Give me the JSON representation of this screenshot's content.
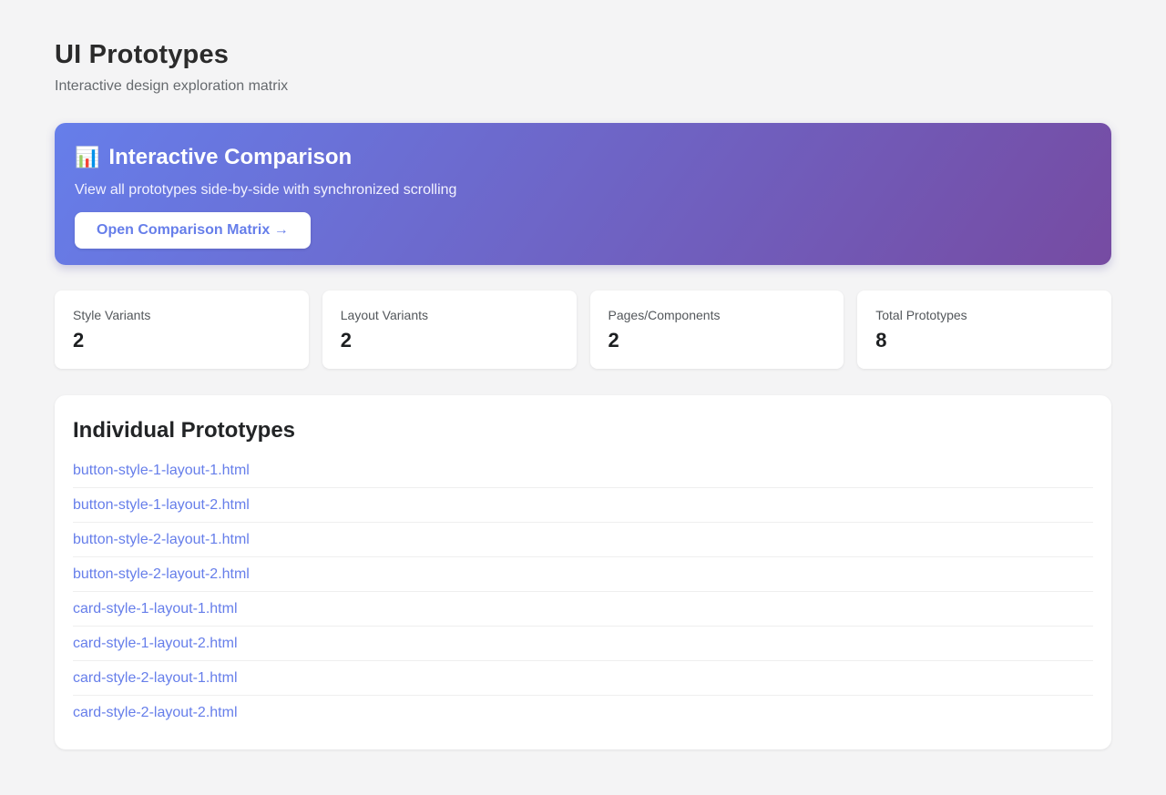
{
  "page": {
    "title": "UI Prototypes",
    "subtitle": "Interactive design exploration matrix"
  },
  "banner": {
    "icon": "📊",
    "title": "Interactive Comparison",
    "description": "View all prototypes side-by-side with synchronized scrolling",
    "button_label": "Open Comparison Matrix →"
  },
  "stats": [
    {
      "label": "Style Variants",
      "value": "2"
    },
    {
      "label": "Layout Variants",
      "value": "2"
    },
    {
      "label": "Pages/Components",
      "value": "2"
    },
    {
      "label": "Total Prototypes",
      "value": "8"
    }
  ],
  "prototypes": {
    "heading": "Individual Prototypes",
    "links": [
      "button-style-1-layout-1.html",
      "button-style-1-layout-2.html",
      "button-style-2-layout-1.html",
      "button-style-2-layout-2.html",
      "card-style-1-layout-1.html",
      "card-style-1-layout-2.html",
      "card-style-2-layout-1.html",
      "card-style-2-layout-2.html"
    ]
  },
  "colors": {
    "accent": "#667eea",
    "gradient_start": "#667eea",
    "gradient_end": "#764ba2",
    "page_background": "#f4f4f5"
  }
}
